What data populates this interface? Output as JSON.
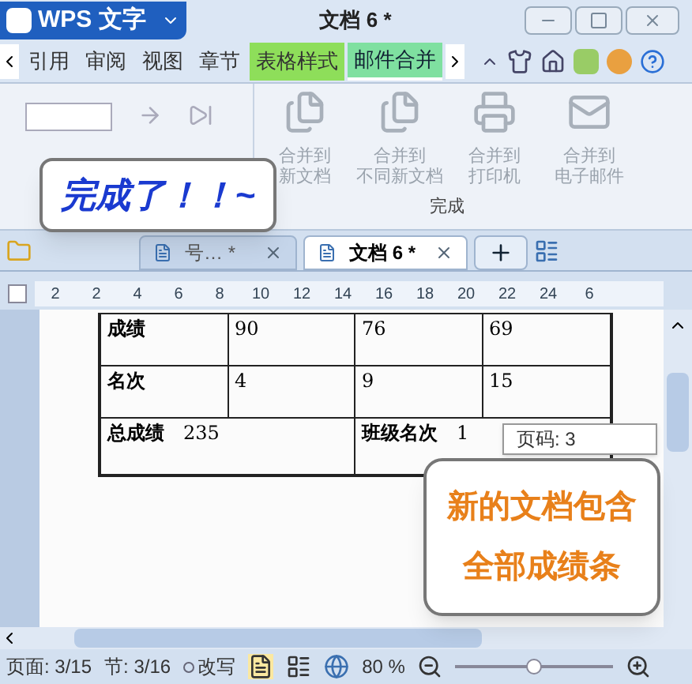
{
  "app_menu": {
    "label": "WPS 文字"
  },
  "window": {
    "title": "文档 6 *"
  },
  "ribbon_tabs": [
    {
      "label": "引用",
      "selected": false,
      "kind": "normal"
    },
    {
      "label": "审阅",
      "selected": false,
      "kind": "normal"
    },
    {
      "label": "视图",
      "selected": false,
      "kind": "normal"
    },
    {
      "label": "章节",
      "selected": false,
      "kind": "normal"
    },
    {
      "label": "表格样式",
      "selected": false,
      "kind": "context"
    },
    {
      "label": "邮件合并",
      "selected": true,
      "kind": "context"
    }
  ],
  "ribbon": {
    "buttons": [
      {
        "lines": [
          "合并到",
          "新文档"
        ],
        "disabled": true,
        "kind": "docs"
      },
      {
        "lines": [
          "合并到",
          "不同新文档"
        ],
        "disabled": true,
        "kind": "docs"
      },
      {
        "lines": [
          "合并到",
          "打印机"
        ],
        "disabled": true,
        "kind": "printer"
      },
      {
        "lines": [
          "合并到",
          "电子邮件"
        ],
        "disabled": true,
        "kind": "mail"
      }
    ],
    "group_label": "完成"
  },
  "callouts": [
    {
      "kind": "title",
      "text": "完成了！！~"
    },
    {
      "kind": "note",
      "text": "新的文档包含全部成绩条"
    }
  ],
  "doc_tabs": [
    {
      "label": "号… *",
      "selected": false
    },
    {
      "label": "文档 6 *",
      "selected": true
    }
  ],
  "ruler": [
    "2",
    "2",
    "4",
    "6",
    "8",
    "10",
    "12",
    "14",
    "16",
    "18",
    "20",
    "22",
    "24",
    "6"
  ],
  "table": {
    "rows": [
      {
        "kind": "scores",
        "label": "成绩",
        "values": [
          "90",
          "76",
          "69"
        ]
      },
      {
        "kind": "scores",
        "label": "名次",
        "values": [
          "4",
          "9",
          "15"
        ]
      },
      {
        "kind": "summary",
        "cells": [
          {
            "label": "总成绩",
            "value": "235"
          },
          {
            "label": "班级名次",
            "value": "1"
          }
        ]
      }
    ]
  },
  "tooltip": {
    "text": "页码: 3"
  },
  "status_bar": {
    "page": "页面: 3/15",
    "section": "节: 3/16",
    "overwrite": "改写",
    "zoom": "80 %",
    "zoom_slider": {
      "level": 0.5
    }
  }
}
